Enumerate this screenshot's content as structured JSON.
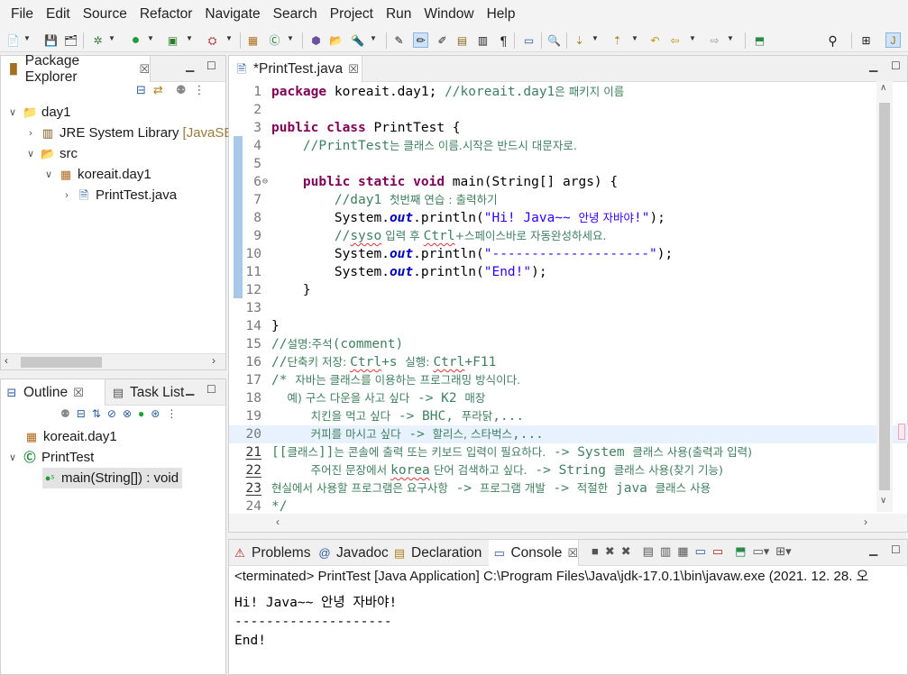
{
  "menubar": [
    "File",
    "Edit",
    "Source",
    "Refactor",
    "Navigate",
    "Search",
    "Project",
    "Run",
    "Window",
    "Help"
  ],
  "toolbar_icons": [
    "new-icon",
    "save-icon",
    "save-all-icon",
    "debug-icon",
    "run-icon",
    "coverage-icon",
    "external-tools-icon",
    "new-java-package-icon",
    "new-java-class-icon",
    "open-type-icon",
    "open-task-icon",
    "search-icon",
    "toggle-mark-occurrences-icon",
    "toggle-block-selection-icon",
    "show-whitespace-icon",
    "next-annotation-icon",
    "previous-annotation-icon",
    "last-edit-location-icon",
    "back-icon",
    "forward-icon",
    "pin-editor-icon",
    "quick-access-search-icon",
    "open-perspective-icon",
    "java-perspective-icon"
  ],
  "package_explorer": {
    "title": "Package Explorer",
    "items": [
      {
        "label": "day1",
        "icon": "project-icon",
        "expanded": true
      },
      {
        "label": "JRE System Library",
        "suffix": "[JavaSE-",
        "icon": "library-icon"
      },
      {
        "label": "src",
        "icon": "source-folder-icon",
        "expanded": true
      },
      {
        "label": "koreait.day1",
        "icon": "package-icon",
        "expanded": true
      },
      {
        "label": "PrintTest.java",
        "icon": "java-file-icon"
      }
    ]
  },
  "outline": {
    "tabs": [
      "Outline",
      "Task List"
    ],
    "items": [
      {
        "label": "koreait.day1",
        "icon": "package-icon"
      },
      {
        "label": "PrintTest",
        "icon": "class-icon"
      },
      {
        "label": "main(String[]) : void",
        "icon": "method-icon"
      }
    ]
  },
  "editor": {
    "tab_title": "*PrintTest.java",
    "current_line": 20,
    "lines": [
      {
        "n": "1",
        "segs": [
          [
            "kw",
            "package"
          ],
          [
            "",
            "koreait.day1; "
          ],
          [
            "cm",
            "//koreait.day1"
          ],
          [
            "cm kr",
            "은 패키지 이름"
          ]
        ]
      },
      {
        "n": "2",
        "segs": []
      },
      {
        "n": "3",
        "segs": [
          [
            "kw",
            "public class"
          ],
          [
            "",
            "PrintTest {"
          ]
        ]
      },
      {
        "n": "4",
        "segs": [
          [
            "",
            "    "
          ],
          [
            "cm",
            "//PrintTest"
          ],
          [
            "cm kr",
            "는 클래스 이름.시작은 반드시 대문자로."
          ]
        ]
      },
      {
        "n": "5",
        "segs": []
      },
      {
        "n": "6",
        "fold": "⊖",
        "segs": [
          [
            "",
            "    "
          ],
          [
            "kw",
            "public static void"
          ],
          [
            "",
            " main(String[] args) {"
          ]
        ]
      },
      {
        "n": "7",
        "segs": [
          [
            "",
            "        "
          ],
          [
            "cm",
            "//day1 "
          ],
          [
            "cm kr",
            "첫번째 연습 : 출력하기"
          ]
        ]
      },
      {
        "n": "8",
        "segs": [
          [
            "",
            "        System."
          ],
          [
            "fld",
            "out"
          ],
          [
            "",
            ".println("
          ],
          [
            "st",
            "\"Hi! Java~~ "
          ],
          [
            "st kr",
            "안녕 자바야"
          ],
          [
            "st",
            "!\""
          ],
          [
            "",
            ");"
          ]
        ]
      },
      {
        "n": "9",
        "segs": [
          [
            "",
            "        "
          ],
          [
            "cm",
            "//"
          ],
          [
            "cm sq",
            "syso"
          ],
          [
            "cm kr",
            " 입력 후 "
          ],
          [
            "cm sq",
            "Ctrl"
          ],
          [
            "cm kr",
            "+스페이스바로 자동완성하세요."
          ]
        ]
      },
      {
        "n": "10",
        "segs": [
          [
            "",
            "        System."
          ],
          [
            "fld",
            "out"
          ],
          [
            "",
            ".println("
          ],
          [
            "st",
            "\"--------------------\""
          ],
          [
            "",
            ");"
          ]
        ]
      },
      {
        "n": "11",
        "segs": [
          [
            "",
            "        System."
          ],
          [
            "fld",
            "out"
          ],
          [
            "",
            ".println("
          ],
          [
            "st",
            "\"End!\""
          ],
          [
            "",
            ");"
          ]
        ]
      },
      {
        "n": "12",
        "segs": [
          [
            "",
            "    }"
          ]
        ]
      },
      {
        "n": "13",
        "segs": []
      },
      {
        "n": "14",
        "segs": [
          [
            "",
            "}"
          ]
        ]
      },
      {
        "n": "15",
        "segs": [
          [
            "cm",
            "//"
          ],
          [
            "cm kr",
            "설명:주석"
          ],
          [
            "cm",
            "(comment)"
          ]
        ]
      },
      {
        "n": "16",
        "segs": [
          [
            "cm",
            "//"
          ],
          [
            "cm kr",
            "단축키 저장: "
          ],
          [
            "cm sq",
            "Ctrl"
          ],
          [
            "cm",
            "+s "
          ],
          [
            "cm kr",
            "실행: "
          ],
          [
            "cm sq",
            "Ctrl"
          ],
          [
            "cm",
            "+F11"
          ]
        ]
      },
      {
        "n": "17",
        "segs": [
          [
            "cm",
            "/* "
          ],
          [
            "cm kr",
            "자바는 클래스를 이용하는 프로그래밍 방식이다."
          ]
        ]
      },
      {
        "n": "18",
        "segs": [
          [
            "cm",
            "  "
          ],
          [
            "cm kr",
            "예) 구스 다운을 사고 싶다"
          ],
          [
            "cm",
            " -> K2 "
          ],
          [
            "cm kr",
            "매장"
          ]
        ]
      },
      {
        "n": "19",
        "segs": [
          [
            "cm",
            "     "
          ],
          [
            "cm kr",
            "치킨을 먹고 싶다"
          ],
          [
            "cm",
            " -> BHC, "
          ],
          [
            "cm kr",
            "푸라닭"
          ],
          [
            "cm",
            ",..."
          ]
        ]
      },
      {
        "n": "20",
        "segs": [
          [
            "cm",
            "     "
          ],
          [
            "cm kr",
            "커피를 마시고 싶다"
          ],
          [
            "cm",
            " -> "
          ],
          [
            "cm kr",
            "할리스, 스타벅스"
          ],
          [
            "cm",
            ",..."
          ]
        ]
      },
      {
        "n": "21",
        "ul": true,
        "segs": [
          [
            "cm",
            "[["
          ],
          [
            "cm kr",
            "클래스"
          ],
          [
            "cm",
            "]]"
          ],
          [
            "cm kr",
            "는 콘솔에 출력 또는 키보드 입력이 필요하다."
          ],
          [
            "cm",
            " -> System "
          ],
          [
            "cm kr",
            "클래스 사용(출력과 입력)"
          ]
        ]
      },
      {
        "n": "22",
        "ul": true,
        "segs": [
          [
            "cm",
            "     "
          ],
          [
            "cm kr",
            "주어진 문장에서 "
          ],
          [
            "cm sq",
            "korea"
          ],
          [
            "cm kr",
            " 단어 검색하고 싶다."
          ],
          [
            "cm",
            " -> String "
          ],
          [
            "cm kr",
            "클래스 사용(찾기 기능)"
          ]
        ]
      },
      {
        "n": "23",
        "ul": true,
        "segs": [
          [
            "cm kr",
            "현실에서 사용할 프로그램은 요구사항"
          ],
          [
            "cm",
            " -> "
          ],
          [
            "cm kr",
            "프로그램 개발"
          ],
          [
            "cm",
            " -> "
          ],
          [
            "cm kr",
            "적절한"
          ],
          [
            "cm",
            " java "
          ],
          [
            "cm kr",
            "클래스 사용"
          ]
        ]
      },
      {
        "n": "24",
        "segs": [
          [
            "cm",
            "*/"
          ]
        ]
      }
    ]
  },
  "bottom_panel": {
    "tabs": [
      "Problems",
      "Javadoc",
      "Declaration",
      "Console"
    ],
    "status": "<terminated> PrintTest [Java Application] C:\\Program Files\\Java\\jdk-17.0.1\\bin\\javaw.exe  (2021. 12. 28. 오",
    "output_lines": [
      "Hi! Java~~ 안녕 자바야!",
      "--------------------",
      "End!"
    ]
  },
  "colors": {
    "keyword": "#7f0055",
    "comment": "#3f7f5f",
    "string": "#2a00ff",
    "field": "#0000c0",
    "current_line": "#e8f2fe"
  }
}
